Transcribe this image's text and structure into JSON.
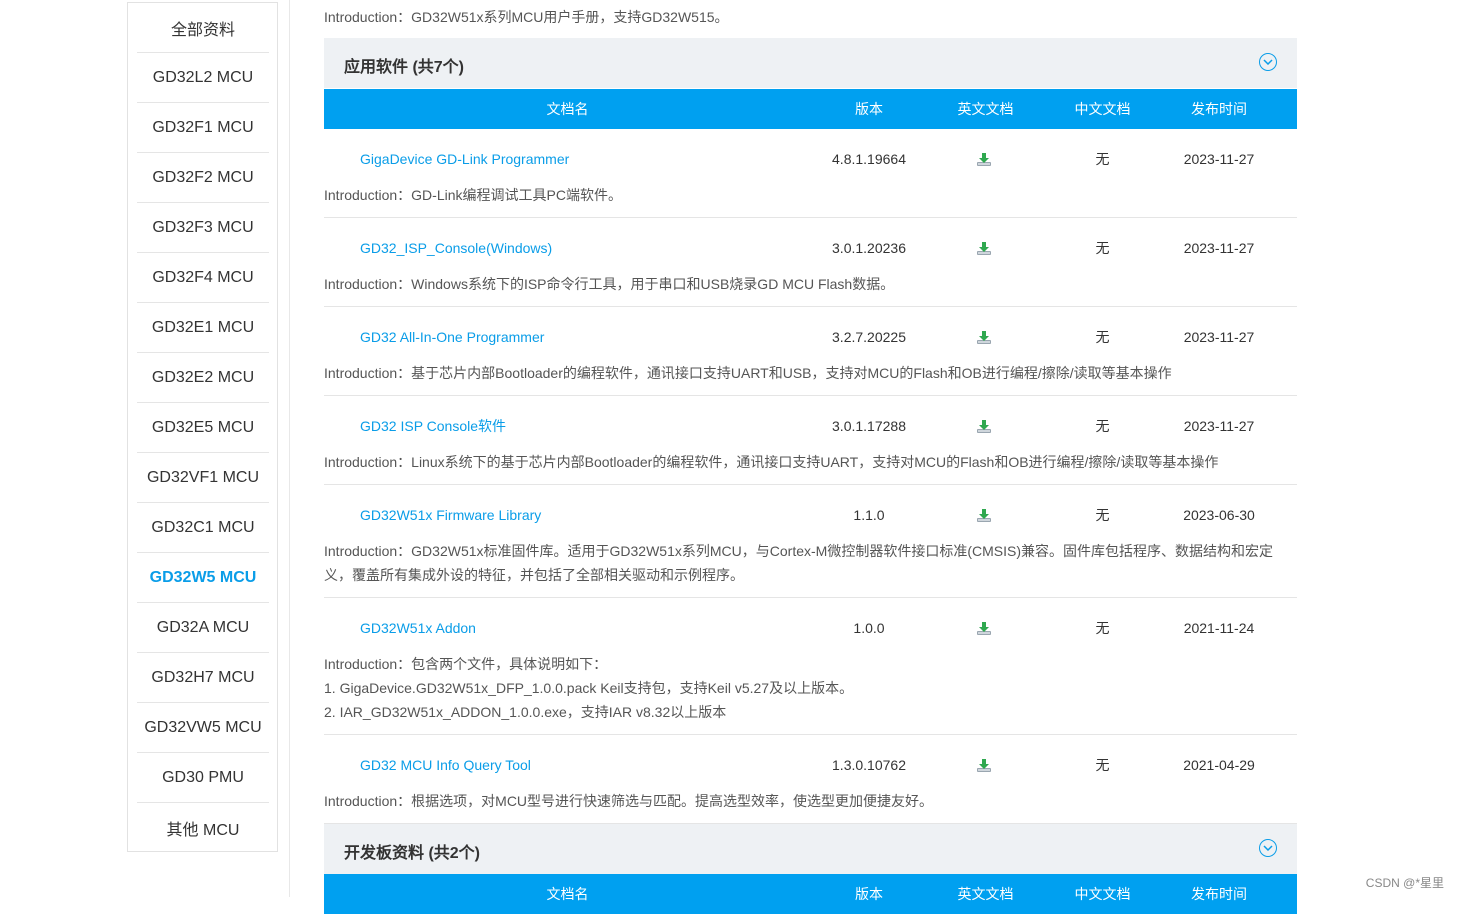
{
  "sidebar": {
    "items": [
      {
        "label": "全部资料",
        "active": false
      },
      {
        "label": "GD32L2  MCU",
        "active": false
      },
      {
        "label": "GD32F1  MCU",
        "active": false
      },
      {
        "label": "GD32F2  MCU",
        "active": false
      },
      {
        "label": "GD32F3  MCU",
        "active": false
      },
      {
        "label": "GD32F4  MCU",
        "active": false
      },
      {
        "label": "GD32E1  MCU",
        "active": false
      },
      {
        "label": "GD32E2  MCU",
        "active": false
      },
      {
        "label": "GD32E5  MCU",
        "active": false
      },
      {
        "label": "GD32VF1  MCU",
        "active": false
      },
      {
        "label": "GD32C1  MCU",
        "active": false
      },
      {
        "label": "GD32W5  MCU",
        "active": true
      },
      {
        "label": "GD32A  MCU",
        "active": false
      },
      {
        "label": "GD32H7  MCU",
        "active": false
      },
      {
        "label": "GD32VW5  MCU",
        "active": false
      },
      {
        "label": "GD30 PMU",
        "active": false
      },
      {
        "label": "其他  MCU",
        "active": false
      }
    ]
  },
  "top_intro": "Introduction：GD32W51x系列MCU用户手册，支持GD32W515。",
  "table_header": {
    "name": "文档名",
    "version": "版本",
    "english": "英文文档",
    "chinese": "中文文档",
    "date": "发布时间"
  },
  "section_software": {
    "title": "应用软件 (共7个)",
    "rows": [
      {
        "name": "GigaDevice GD-Link Programmer",
        "version": "4.8.1.19664",
        "chinese": "无",
        "date": "2023-11-27",
        "intro": [
          "Introduction：GD-Link编程调试工具PC端软件。"
        ]
      },
      {
        "name": "GD32_ISP_Console(Windows)",
        "version": "3.0.1.20236",
        "chinese": "无",
        "date": "2023-11-27",
        "intro": [
          "Introduction：Windows系统下的ISP命令行工具，用于串口和USB烧录GD MCU Flash数据。"
        ]
      },
      {
        "name": "GD32 All-In-One Programmer",
        "version": "3.2.7.20225",
        "chinese": "无",
        "date": "2023-11-27",
        "intro": [
          "Introduction：基于芯片内部Bootloader的编程软件，通讯接口支持UART和USB，支持对MCU的Flash和OB进行编程/擦除/读取等基本操作"
        ]
      },
      {
        "name": "GD32 ISP Console软件",
        "version": "3.0.1.17288",
        "chinese": "无",
        "date": "2023-11-27",
        "intro": [
          "Introduction：Linux系统下的基于芯片内部Bootloader的编程软件，通讯接口支持UART，支持对MCU的Flash和OB进行编程/擦除/读取等基本操作"
        ]
      },
      {
        "name": "GD32W51x Firmware Library",
        "version": "1.1.0",
        "chinese": "无",
        "date": "2023-06-30",
        "intro": [
          "Introduction：GD32W51x标准固件库。适用于GD32W51x系列MCU，与Cortex-M微控制器软件接口标准(CMSIS)兼容。固件库包括程序、数据结构和宏定",
          "义，覆盖所有集成外设的特征，并包括了全部相关驱动和示例程序。"
        ]
      },
      {
        "name": "GD32W51x Addon",
        "version": "1.0.0",
        "chinese": "无",
        "date": "2021-11-24",
        "intro": [
          "Introduction：包含两个文件，具体说明如下：",
          "1. GigaDevice.GD32W51x_DFP_1.0.0.pack Keil支持包，支持Keil v5.27及以上版本。",
          "2. IAR_GD32W51x_ADDON_1.0.0.exe，支持IAR v8.32以上版本"
        ]
      },
      {
        "name": "GD32 MCU Info Query Tool",
        "version": "1.3.0.10762",
        "chinese": "无",
        "date": "2021-04-29",
        "intro": [
          "Introduction：根据选项，对MCU型号进行快速筛选与匹配。提高选型效率，使选型更加便捷友好。"
        ]
      }
    ]
  },
  "section_boards": {
    "title": "开发板资料 (共2个)"
  },
  "watermark": "CSDN @*星里",
  "icons": {
    "download": "download-icon",
    "toggle": "chevron-down-circle-icon"
  },
  "colors": {
    "accent": "#00a0f0",
    "link": "#0a9de8",
    "section_bg": "#eef1f4"
  }
}
